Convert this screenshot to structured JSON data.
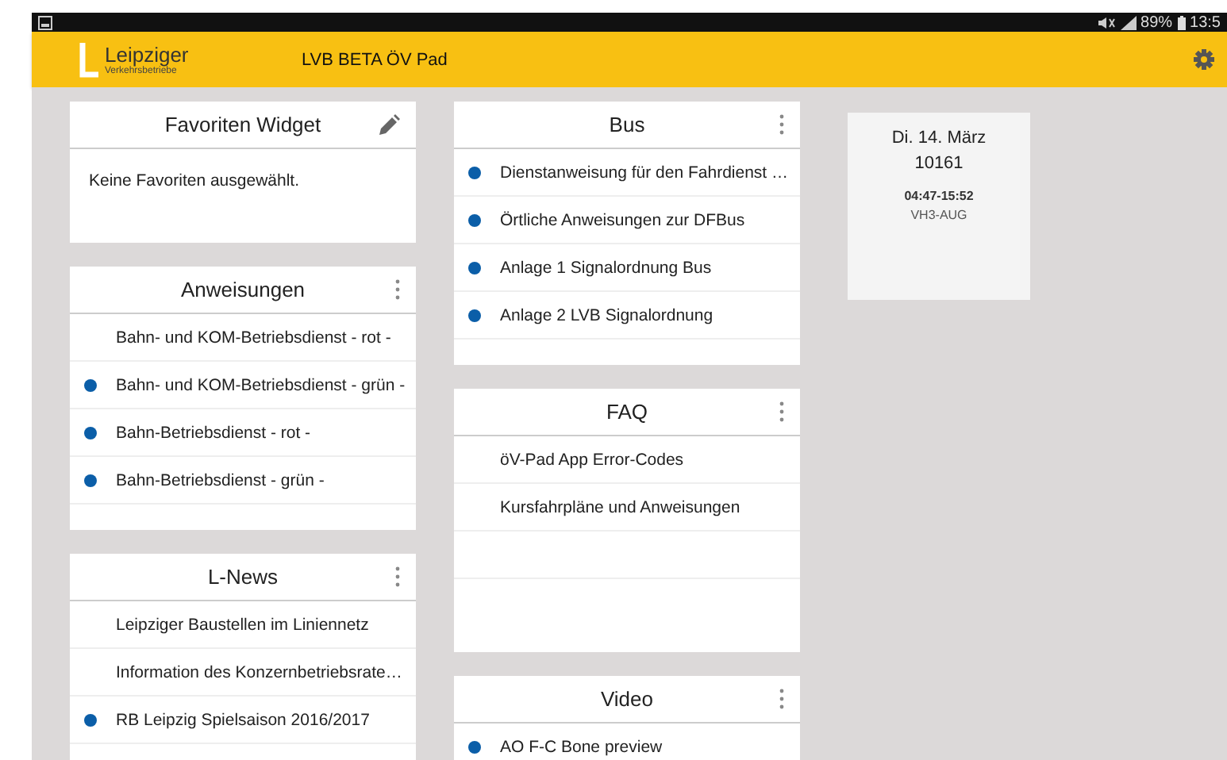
{
  "status_bar": {
    "battery": "89%",
    "time": "13:5"
  },
  "app_bar": {
    "logo_name": "Leipziger",
    "logo_sub": "Verkehrsbetriebe",
    "title": "LVB BETA ÖV Pad"
  },
  "columns": [
    [
      {
        "title": "Favoriten Widget",
        "kind": "edit",
        "text": "Keine Favoriten ausgewählt."
      },
      {
        "title": "Anweisungen",
        "kind": "menu",
        "items": [
          {
            "label": "Bahn- und KOM-Betriebsdienst - rot -",
            "unread": false
          },
          {
            "label": "Bahn- und KOM-Betriebsdienst - grün -",
            "unread": true
          },
          {
            "label": "Bahn-Betriebsdienst - rot -",
            "unread": true
          },
          {
            "label": "Bahn-Betriebsdienst - grün -",
            "unread": true
          }
        ]
      },
      {
        "title": "L-News",
        "kind": "menu",
        "items": [
          {
            "label": "Leipziger Baustellen im Liniennetz",
            "unread": false
          },
          {
            "label": "Information des Konzernbetriebsrate…",
            "unread": false
          },
          {
            "label": "RB Leipzig Spielsaison 2016/2017",
            "unread": true
          }
        ]
      }
    ],
    [
      {
        "title": "Bus",
        "kind": "menu",
        "items": [
          {
            "label": "Dienstanweisung für den Fahrdienst …",
            "unread": true
          },
          {
            "label": "Örtliche Anweisungen zur DFBus",
            "unread": true
          },
          {
            "label": "Anlage 1 Signalordnung Bus",
            "unread": true
          },
          {
            "label": "Anlage 2 LVB Signalordnung",
            "unread": true
          }
        ]
      },
      {
        "title": "FAQ",
        "kind": "menu",
        "items": [
          {
            "label": "öV-Pad App Error-Codes",
            "unread": false
          },
          {
            "label": "Kursfahrpläne und Anweisungen",
            "unread": false
          }
        ]
      },
      {
        "title": "Video",
        "kind": "menu",
        "items": [
          {
            "label": "AO F-C Bone preview",
            "unread": true
          }
        ]
      }
    ]
  ],
  "shift": {
    "date": "Di. 14. März",
    "number": "10161",
    "time": "04:47-15:52",
    "code": "VH3-AUG"
  }
}
